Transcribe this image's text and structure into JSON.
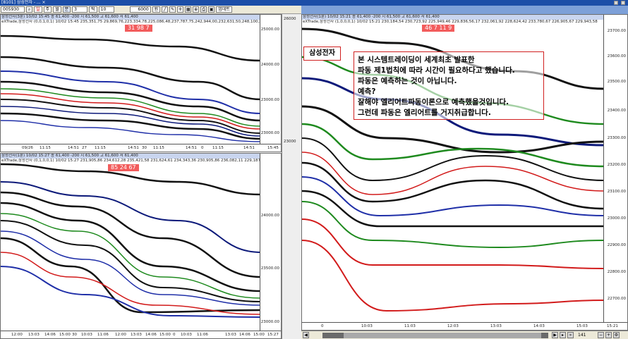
{
  "window": {
    "title": "[8101] 삼성전자 - ... ×"
  },
  "toolbar": {
    "code": "005930",
    "buttons": [
      "일",
      "주",
      "월",
      "분",
      "3",
      "틱",
      "10"
    ],
    "amount": "6000",
    "unit": "원",
    "update_label": "업데트"
  },
  "panels": {
    "top_left": {
      "header": "삼성전자(3분) 10/02 15:45 종 61,400 -200 시 61,500 고 61,600 저 61,400",
      "sub": "eXTrade,삼성전자 (0,0,1,0,1) 10/02 15:45 235,351,75 29,869,76,223,334,78,225,086,48,237,787,75,242,944,00,232,631,50,248,100,25,227,475,25",
      "badge": "31 98 7",
      "y_ticks": [
        "25000.00",
        "24000.00",
        "23000.00"
      ],
      "x_ticks": [
        "09/26",
        "11:15",
        "14:51",
        "27",
        "11:15",
        "14:51",
        "30",
        "11:15",
        "14:51",
        "0",
        "11:15",
        "14:51"
      ],
      "time": "15:45"
    },
    "bottom_left": {
      "header": "삼성전자(1분) 10/02 15:27 종 61,400 -200 시 61,500 고 61,600 저 61,400",
      "sub": "eXTrade,삼성전자 (0,1,0,0,1) 10/02 15:27 231,905,86 234,612,28 235,421,58 231,624,61 234,343,36 230,905,86 236,082,11 229,187,11",
      "badge": "85 24 67",
      "y_ticks": [
        "24000.00",
        "23500.00",
        "23000.00"
      ],
      "x_ticks": [
        "12:00",
        "13:03",
        "14:06",
        "15:00",
        "30",
        "10:03",
        "11:06",
        "12:00",
        "13:03",
        "14:06",
        "15:00",
        "0",
        "10:03",
        "11:06",
        "13:03",
        "14:06",
        "15:00"
      ],
      "time": "15:27"
    },
    "right": {
      "header": "삼성전자(1분) 10/02 15:21 종 61,400 -200 시 61,500 고 61,600 저 61,400",
      "sub": "eXTrade,삼성전자 (1,0,0,0,1) 10/02 15:21 230,184,54 230,723,92 225,949,46 229,836,56,17 232,061,92 228,624,42 233,780,67 226,905,67 229,943,58",
      "badge": "46 7 11 9",
      "tag": "삼성전자",
      "y_ticks": [
        "23700.00",
        "23600.00",
        "23500.00",
        "23400.00",
        "23300.00",
        "23200.00",
        "23100.00",
        "23000.00",
        "22900.00",
        "22800.00",
        "22700.00"
      ],
      "x_ticks": [
        "0",
        "10:03",
        "11:03",
        "12:03",
        "13:03",
        "14:03",
        "15:03"
      ],
      "time": "15:21"
    }
  },
  "annotation": {
    "lines": [
      "본 시스템트레이딩이 세계최초 발표한",
      "파동 제1법칙에 따라 시간이 필요하다고 했습니다.",
      "파동은 예측하는 것이 아닙니다.",
      "예측?",
      "잘해야 엘리어트파동이론으로 예측했을것입니다.",
      "그런데 파동은 엘리어트를 거지취급합니다."
    ]
  },
  "scroll": {
    "count": "141"
  },
  "colors": {
    "black": "#111111",
    "blue": "#1f2fa8",
    "green": "#1e8a1e",
    "red": "#d21b1b",
    "navy": "#0d1a7a"
  }
}
